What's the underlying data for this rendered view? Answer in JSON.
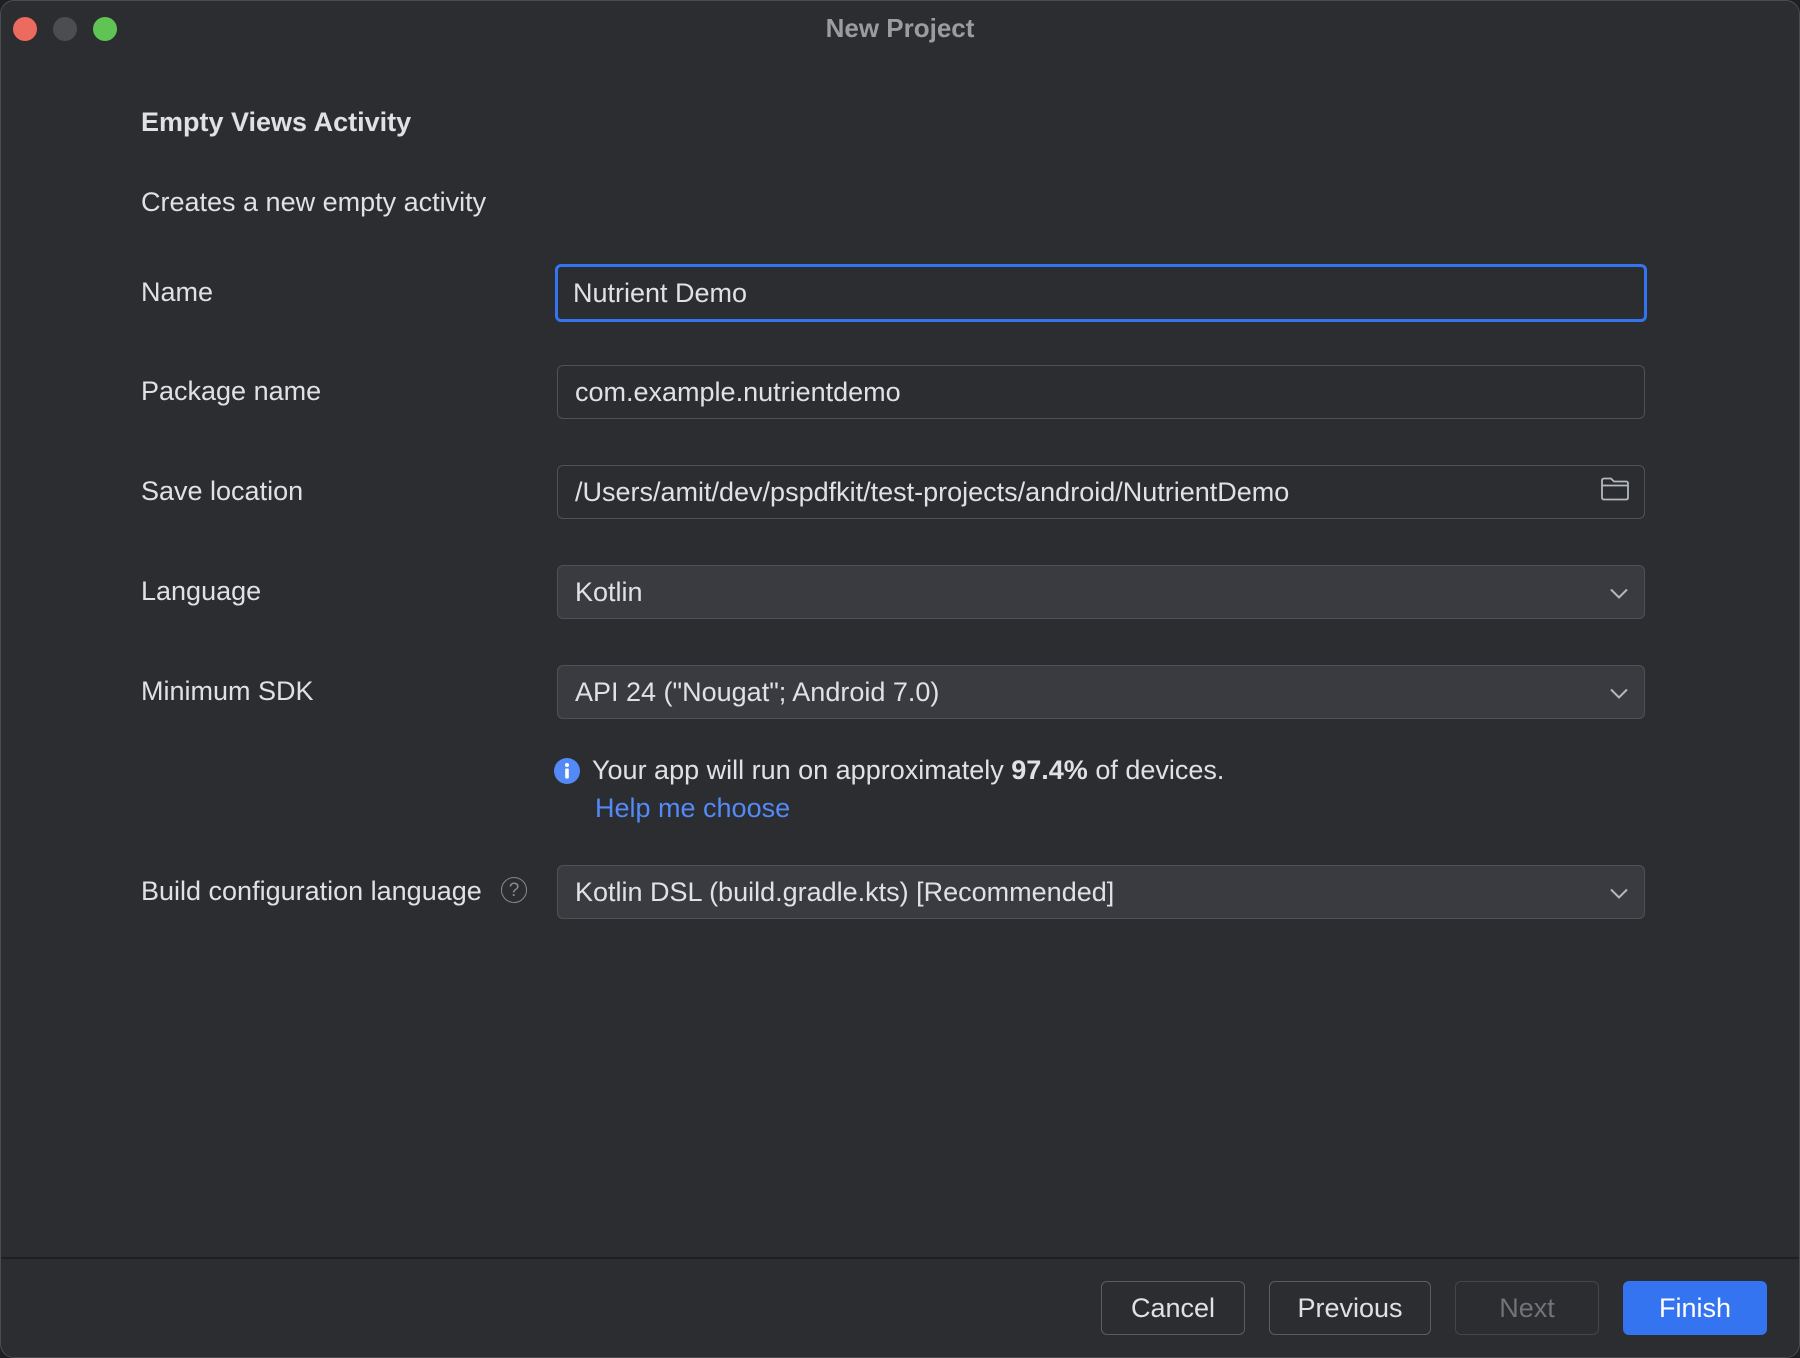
{
  "window": {
    "title": "New Project"
  },
  "template": {
    "heading": "Empty Views Activity",
    "description": "Creates a new empty activity"
  },
  "form": {
    "name": {
      "label": "Name",
      "value": "Nutrient Demo"
    },
    "package_name": {
      "label": "Package name",
      "value": "com.example.nutrientdemo"
    },
    "save_location": {
      "label": "Save location",
      "value": "/Users/amit/dev/pspdfkit/test-projects/android/NutrientDemo"
    },
    "language": {
      "label": "Language",
      "value": "Kotlin"
    },
    "minimum_sdk": {
      "label": "Minimum SDK",
      "value": "API 24 (\"Nougat\"; Android 7.0)"
    },
    "device_hint": {
      "prefix": "Your app will run on approximately ",
      "percent": "97.4%",
      "suffix": " of devices.",
      "help_link": "Help me choose"
    },
    "build_config_language": {
      "label": "Build configuration language",
      "value": "Kotlin DSL (build.gradle.kts) [Recommended]"
    }
  },
  "buttons": {
    "cancel": "Cancel",
    "previous": "Previous",
    "next": "Next",
    "finish": "Finish"
  },
  "icons": {
    "folder": "folder-icon",
    "chevron": "chevron-down-icon",
    "info": "info-icon",
    "help": "question-mark-icon"
  },
  "colors": {
    "accent": "#3574f0",
    "link": "#548af7",
    "background": "#2b2d30"
  }
}
